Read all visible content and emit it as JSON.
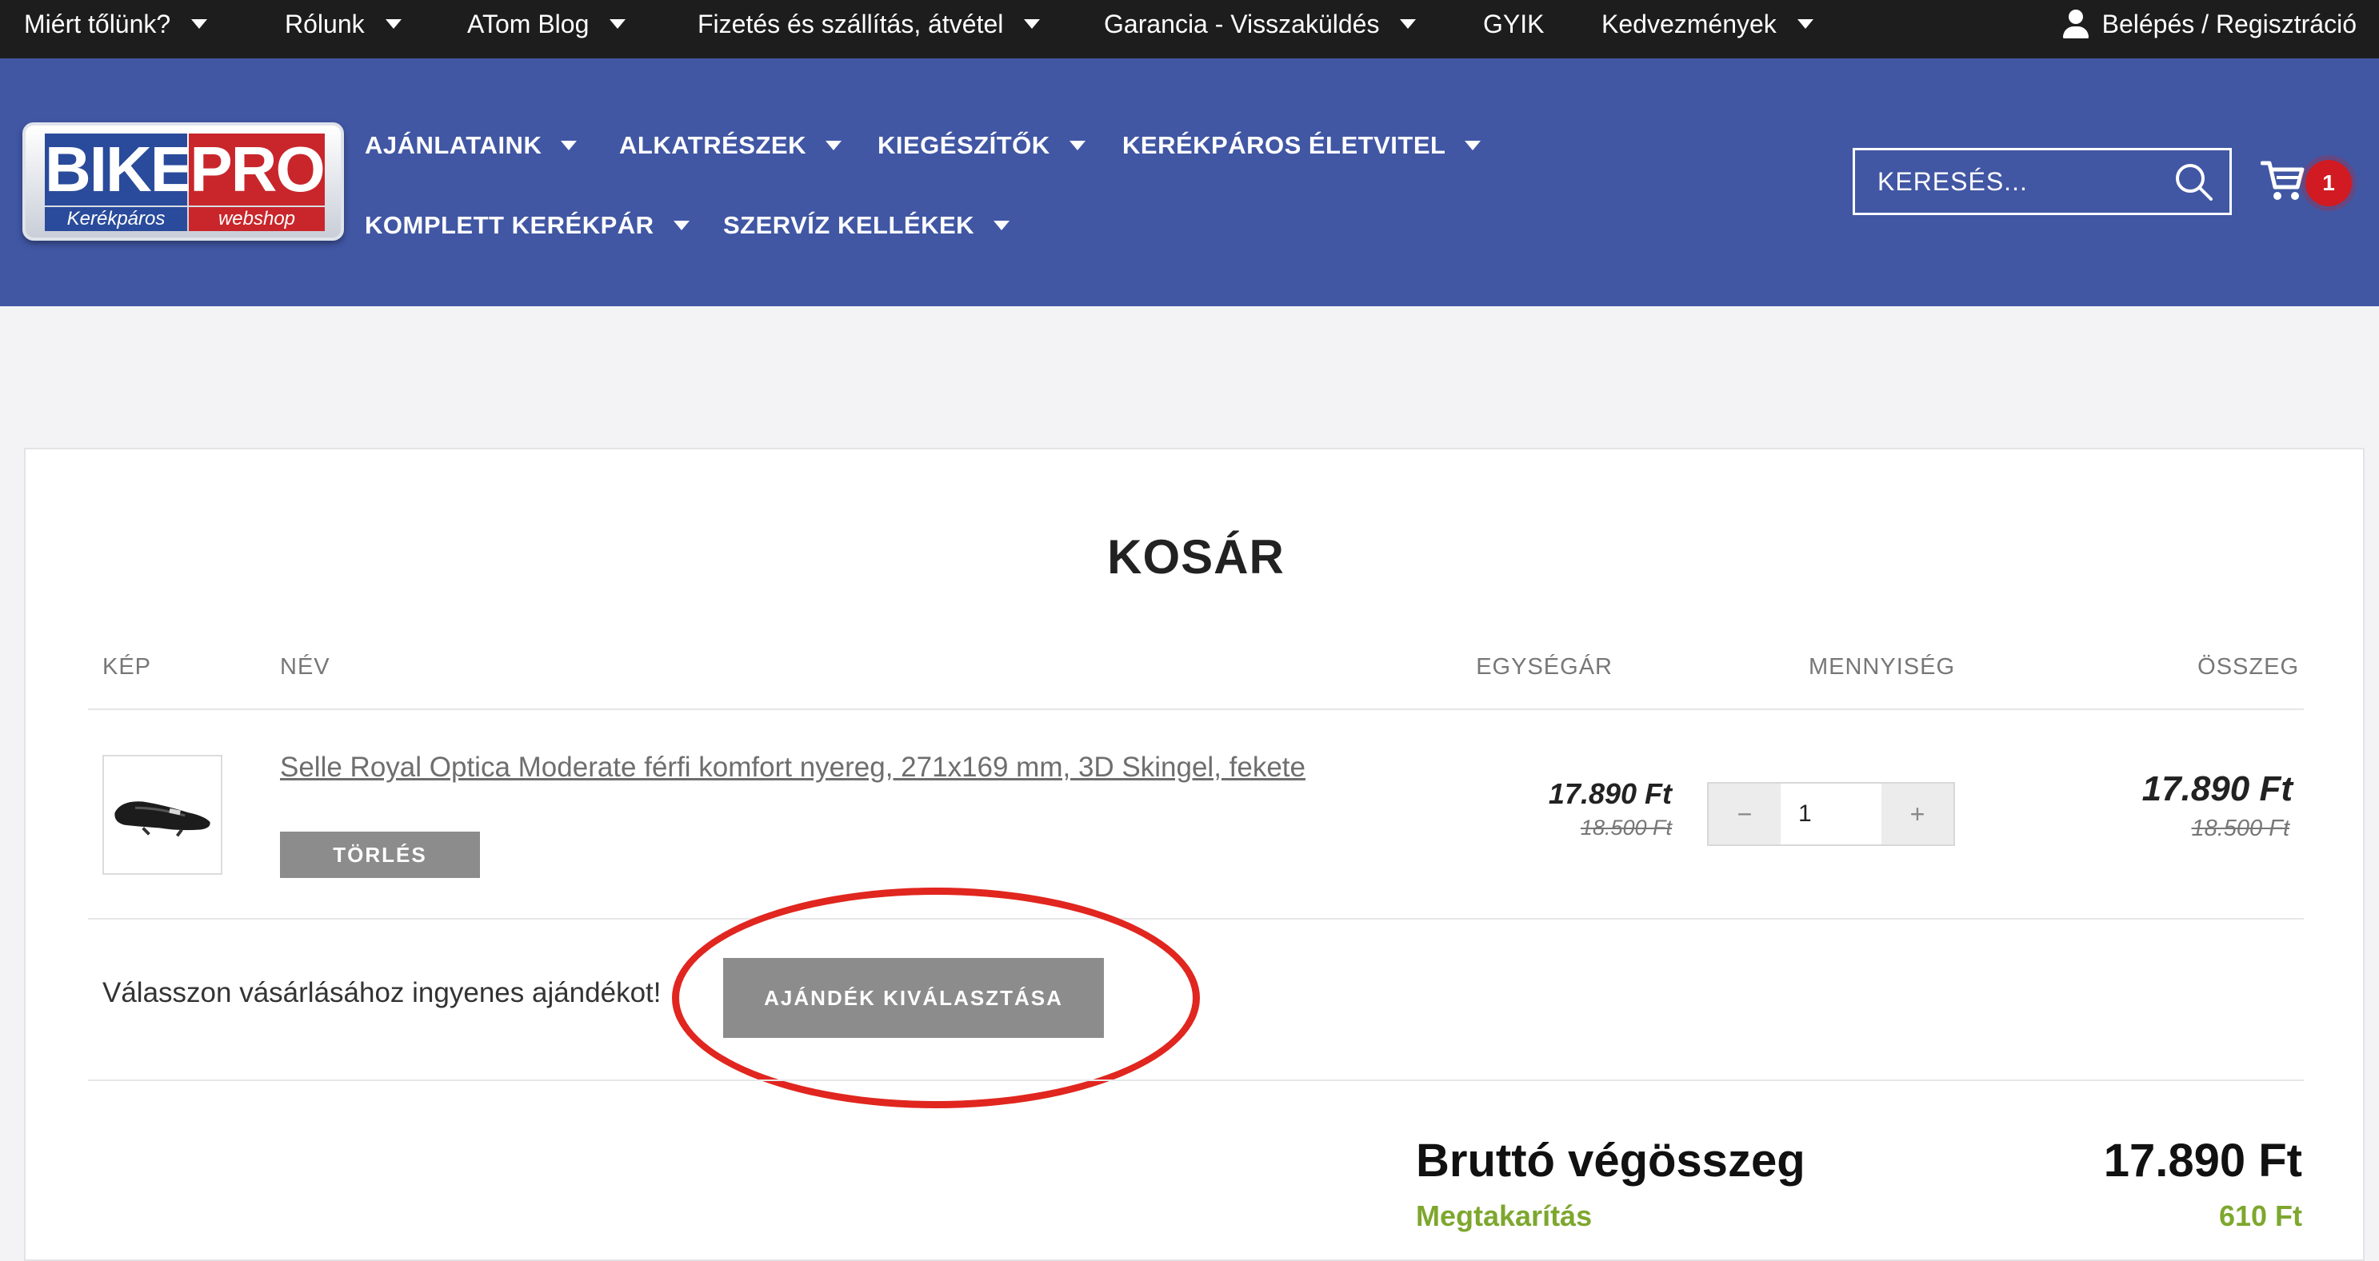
{
  "topbar": {
    "items": [
      {
        "label": "Miért tőlünk?"
      },
      {
        "label": "Rólunk"
      },
      {
        "label": "ATom Blog"
      },
      {
        "label": "Fizetés és szállítás, átvétel"
      },
      {
        "label": "Garancia - Visszaküldés"
      },
      {
        "label": "GYIK"
      },
      {
        "label": "Kedvezmények"
      }
    ],
    "login_label": "Belépés / Regisztráció"
  },
  "header": {
    "logo": {
      "word1": "BIKE",
      "word2": "PRO",
      "sub1": "Kerékpáros",
      "sub2": "webshop"
    },
    "nav": [
      {
        "label": "AJÁNLATAINK"
      },
      {
        "label": "ALKATRÉSZEK"
      },
      {
        "label": "KIEGÉSZÍTŐK"
      },
      {
        "label": "KERÉKPÁROS ÉLETVITEL"
      },
      {
        "label": "KOMPLETT KERÉKPÁR"
      },
      {
        "label": "SZERVÍZ KELLÉKEK"
      }
    ],
    "search_placeholder": "KERESÉS...",
    "cart_count": "1"
  },
  "cart": {
    "title": "KOSÁR",
    "columns": {
      "image": "KÉP",
      "name": "NÉV",
      "unit_price": "EGYSÉGÁR",
      "quantity": "MENNYISÉG",
      "total": "ÖSSZEG"
    },
    "items": [
      {
        "name": "Selle Royal Optica Moderate férfi komfort nyereg, 271x169 mm, 3D Skingel, fekete",
        "delete_label": "TÖRLÉS",
        "unit_price": "17.890 Ft",
        "unit_price_old": "18.500 Ft",
        "quantity": "1",
        "minus": "−",
        "plus": "+",
        "total": "17.890 Ft",
        "total_old": "18.500 Ft"
      }
    ],
    "gift_text": "Válasszon vásárlásához ingyenes ajándékot!",
    "gift_button": "AJÁNDÉK KIVÁLASZTÁSA",
    "gross_total_label": "Bruttó végösszeg",
    "gross_total_value": "17.890 Ft",
    "savings_label": "Megtakarítás",
    "savings_value": "610 Ft"
  },
  "colors": {
    "topbar": "#1d1d1d",
    "header": "#4157a4",
    "badge": "#d11a22",
    "savings": "#7ea72e",
    "annotation": "#e0261f"
  },
  "icons": {
    "login": "user-icon",
    "search": "search-icon",
    "cart": "cart-icon"
  }
}
